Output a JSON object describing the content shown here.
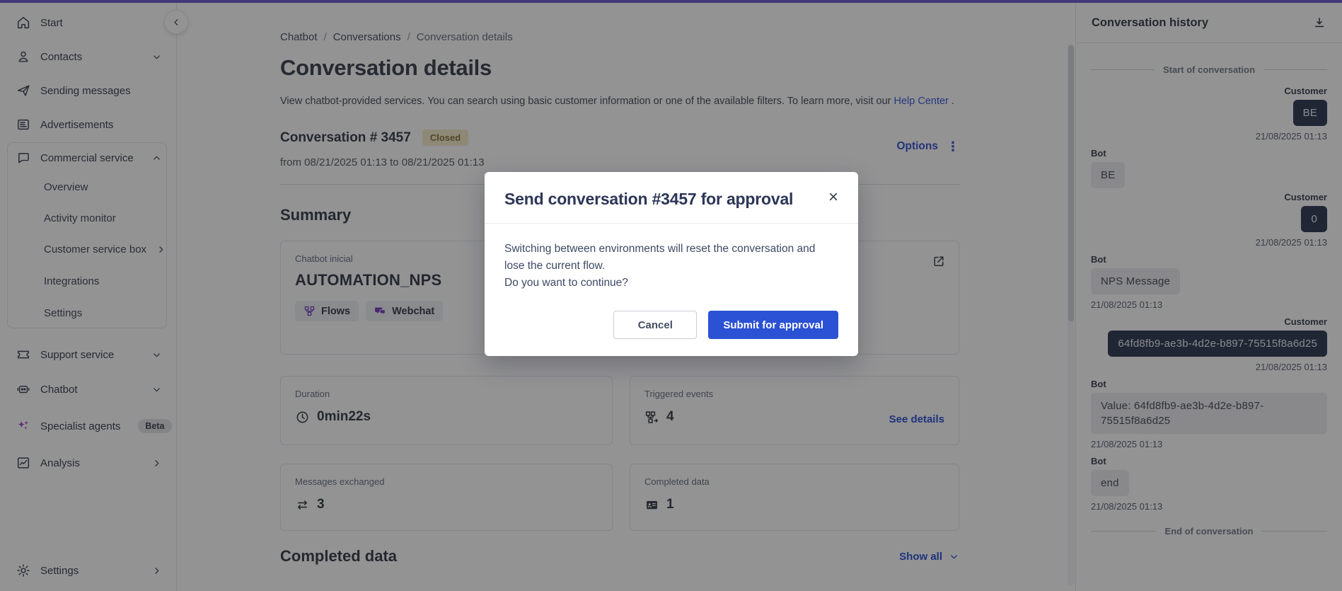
{
  "sidebar": {
    "start": "Start",
    "contacts": "Contacts",
    "sending": "Sending messages",
    "advertisements": "Advertisements",
    "commercial": "Commercial service",
    "overview": "Overview",
    "activity_monitor": "Activity monitor",
    "customer_service_box": "Customer service box",
    "integrations": "Integrations",
    "commercial_settings": "Settings",
    "support": "Support service",
    "chatbot": "Chatbot",
    "specialist_agents": "Specialist agents",
    "beta_badge": "Beta",
    "analysis": "Analysis",
    "settings": "Settings"
  },
  "breadcrumb": {
    "items": [
      "Chatbot",
      "Conversations",
      "Conversation details"
    ],
    "separator": "/"
  },
  "page": {
    "title": "Conversation details",
    "subtitle_pre": "View chatbot-provided services. You can search using basic customer information or one of the available filters. To learn more, visit our",
    "help_link": "Help Center",
    "subtitle_post": ".",
    "conversation_title": "Conversation # 3457",
    "status_badge": "Closed",
    "date_range": "from 08/21/2025 01:13 to 08/21/2025 01:13",
    "options_label": "Options",
    "options_menu_icon": "⋮"
  },
  "summary": {
    "heading": "Summary",
    "chatbot_card": {
      "label": "Chatbot inicial",
      "value": "AUTOMATION_NPS",
      "tags": [
        {
          "label": "Flows"
        },
        {
          "label": "Webchat"
        }
      ]
    },
    "duration": {
      "label": "Duration",
      "value": "0min22s"
    },
    "triggered": {
      "label": "Triggered events",
      "value": "4",
      "link": "See details"
    },
    "messages": {
      "label": "Messages exchanged",
      "value": "3"
    },
    "completed": {
      "label": "Completed data",
      "value": "1"
    }
  },
  "completed_section": {
    "heading": "Completed data",
    "show_all": "Show all"
  },
  "modal": {
    "title": "Send conversation #3457 for approval",
    "close_icon": "×",
    "body_line1": "Switching between environments will reset the conversation and lose the current flow.",
    "body_line2": "Do you want to continue?",
    "cancel_label": "Cancel",
    "submit_label": "Submit for approval"
  },
  "history": {
    "title": "Conversation history",
    "start_divider": "Start of conversation",
    "end_divider": "End of conversation",
    "messages": [
      {
        "sender": "Customer",
        "text": "BE",
        "time": "21/08/2025 01:13"
      },
      {
        "sender": "Bot",
        "text": "BE",
        "time": ""
      },
      {
        "sender": "Customer",
        "text": "0",
        "time": "21/08/2025 01:13"
      },
      {
        "sender": "Bot",
        "text": "NPS Message",
        "time": "21/08/2025 01:13"
      },
      {
        "sender": "Customer",
        "text": "64fd8fb9-ae3b-4d2e-b897-75515f8a6d25",
        "time": "21/08/2025 01:13"
      },
      {
        "sender": "Bot",
        "text": "Value: 64fd8fb9-ae3b-4d2e-b897-75515f8a6d25",
        "time": "21/08/2025 01:13"
      },
      {
        "sender": "Bot",
        "text": "end",
        "time": "21/08/2025 01:13"
      }
    ]
  },
  "colors": {
    "topbar_purple": "#6e5bd0",
    "accent_blue": "#2b51d4",
    "link_blue": "#3b57cf",
    "tag_icon_purple": "#7a3fc1",
    "sparkle_purple": "#a244c7",
    "closed_badge_bg": "#f6ebc9",
    "closed_badge_text": "#8a7540",
    "customer_bubble": "#333e55",
    "bot_bubble": "#ededef"
  }
}
